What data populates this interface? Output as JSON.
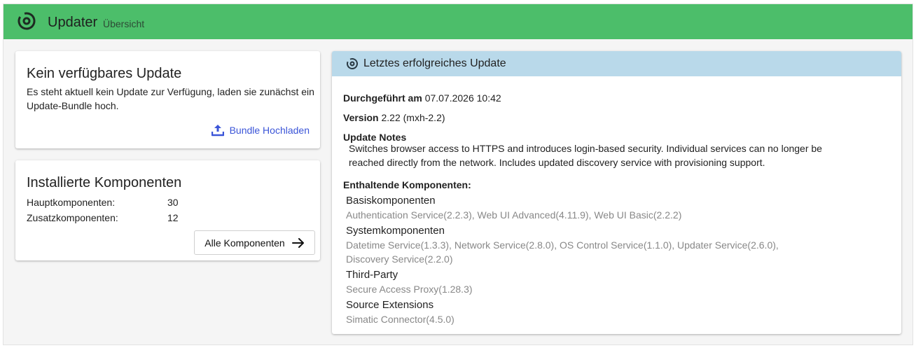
{
  "header": {
    "title": "Updater",
    "subtitle": "Übersicht",
    "bg_color": "#4cbe6a"
  },
  "update_card": {
    "title": "Kein verfügbares Update",
    "description": "Es steht aktuell kein Update zur Verfügung, laden sie zunächst ein Update-Bundle hoch.",
    "upload_label": "Bundle Hochladen",
    "upload_icon": "upload-icon",
    "link_color": "#3b55d8"
  },
  "components_card": {
    "title": "Installierte Komponenten",
    "rows": [
      {
        "label": "Hauptkomponenten:",
        "value": "30"
      },
      {
        "label": "Zusatzkomponenten:",
        "value": "12"
      }
    ],
    "button_label": "Alle Komponenten",
    "button_icon": "arrow-right-icon"
  },
  "last_update": {
    "title": "Letztes erfolgreiches Update",
    "header_color": "#b9d9ea",
    "performed_label": "Durchgeführt am",
    "performed_value": "07.07.2026 10:42",
    "version_label": "Version",
    "version_value": "2.22 (mxh-2.2)",
    "notes_label": "Update Notes",
    "notes_text": "Switches browser access to HTTPS and introduces login-based security. Individual services can no longer be reached directly from the network. Includes updated discovery service with provisioning support.",
    "included_label": "Enthaltende Komponenten:",
    "groups": [
      {
        "name": "Basiskomponenten",
        "items": "Authentication Service(2.2.3), Web UI Advanced(4.11.9), Web UI Basic(2.2.2)"
      },
      {
        "name": "Systemkomponenten",
        "items": "Datetime Service(1.3.3), Network Service(2.8.0), OS Control Service(1.1.0), Updater Service(2.6.0), Discovery Service(2.2.0)"
      },
      {
        "name": "Third-Party",
        "items": "Secure Access Proxy(1.28.3)"
      },
      {
        "name": "Source Extensions",
        "items": "Simatic Connector(4.5.0)"
      }
    ]
  }
}
